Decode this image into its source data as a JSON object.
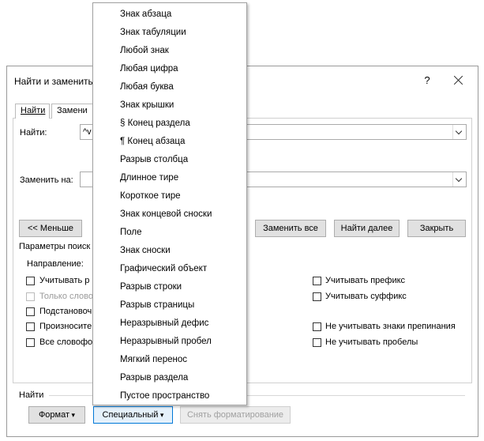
{
  "dialog": {
    "title": "Найти и заменить",
    "help": "?",
    "tabs": [
      "Найти",
      "Замени"
    ]
  },
  "find": {
    "label": "Найти:",
    "value": "^v"
  },
  "replace": {
    "label": "Заменить на:",
    "value": ""
  },
  "buttons": {
    "less": "<< Меньше",
    "replace_all": "Заменить все",
    "find_next": "Найти далее",
    "close": "Закрыть"
  },
  "options": {
    "section_title": "Параметры поиск",
    "direction_label": "Направление:",
    "left_checks": [
      {
        "label": "Учитывать р",
        "checked": false,
        "disabled": false
      },
      {
        "label": "Только слово",
        "checked": false,
        "disabled": true
      },
      {
        "label": "Подстановоч",
        "checked": false,
        "disabled": false
      },
      {
        "label": "Произносите",
        "checked": false,
        "disabled": false
      },
      {
        "label": "Все словофо",
        "checked": false,
        "disabled": false
      }
    ],
    "right_checks": [
      {
        "label": "Учитывать префикс",
        "checked": false
      },
      {
        "label": "Учитывать суффикс",
        "checked": false
      },
      {
        "label": "Не учитывать знаки препинания",
        "checked": false
      },
      {
        "label": "Не учитывать пробелы",
        "checked": false
      }
    ]
  },
  "footer": {
    "find_title": "Найти",
    "format": "Формат",
    "special": "Специальный",
    "no_format": "Снять форматирование"
  },
  "menu": {
    "items": [
      "Знак абзаца",
      "Знак табуляции",
      "Любой знак",
      "Любая цифра",
      "Любая буква",
      "Знак крышки",
      "§ Конец раздела",
      "¶ Конец абзаца",
      "Разрыв столбца",
      "Длинное тире",
      "Короткое тире",
      "Знак концевой сноски",
      "Поле",
      "Знак сноски",
      "Графический объект",
      "Разрыв строки",
      "Разрыв страницы",
      "Неразрывный дефис",
      "Неразрывный пробел",
      "Мягкий перенос",
      "Разрыв раздела",
      "Пустое пространство"
    ]
  }
}
